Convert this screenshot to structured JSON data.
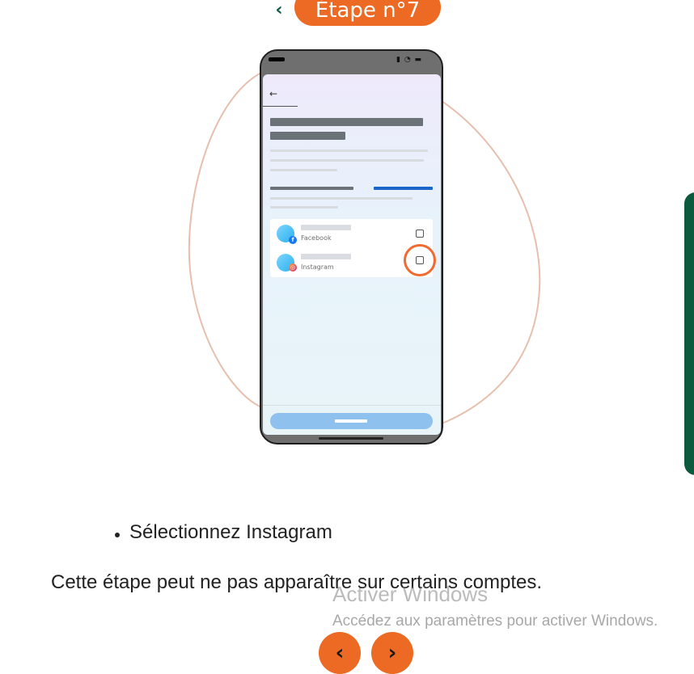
{
  "header": {
    "back_icon": "chevron-left-icon",
    "step_label": "Étape n°7"
  },
  "phone": {
    "status_icons": "signal wifi battery",
    "accounts": [
      {
        "label": "Facebook",
        "badge_icon": "facebook-icon",
        "badge_char": "f"
      },
      {
        "label": "Instagram",
        "badge_icon": "instagram-icon",
        "badge_char": "◎"
      }
    ]
  },
  "content": {
    "bullet_prefix": "Sélectionnez ",
    "bullet_target": "Instagram",
    "note": "Cette étape peut ne pas apparaître sur certains comptes."
  },
  "watermark": {
    "title": "Activer Windows",
    "subtitle": "Accédez aux paramètres pour activer Windows."
  },
  "nav": {
    "prev_icon": "chevron-left-icon",
    "next_icon": "chevron-right-icon"
  },
  "colors": {
    "accent": "#ec6a24",
    "brand_green": "#0b5a3e",
    "highlight": "#ef6b32"
  }
}
